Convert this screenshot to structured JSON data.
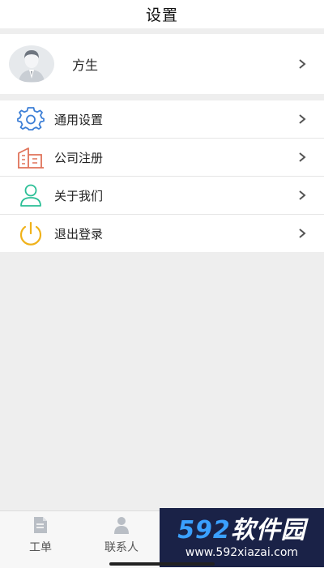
{
  "header": {
    "title": "设置"
  },
  "profile": {
    "name": "方生",
    "avatar_icon": "user-avatar"
  },
  "menu": [
    {
      "label": "通用设置",
      "icon": "gear-icon",
      "color": "#3d7fd6"
    },
    {
      "label": "公司注册",
      "icon": "building-icon",
      "color": "#e0735a"
    },
    {
      "label": "关于我们",
      "icon": "person-icon",
      "color": "#2bbf96"
    },
    {
      "label": "退出登录",
      "icon": "power-icon",
      "color": "#f0b21a"
    }
  ],
  "tabs": [
    {
      "label": "工单",
      "icon": "document-icon"
    },
    {
      "label": "联系人",
      "icon": "contact-icon"
    }
  ],
  "watermark": {
    "brand_num": "592",
    "brand_text": "软件园",
    "url": "www.592xiazai.com"
  }
}
